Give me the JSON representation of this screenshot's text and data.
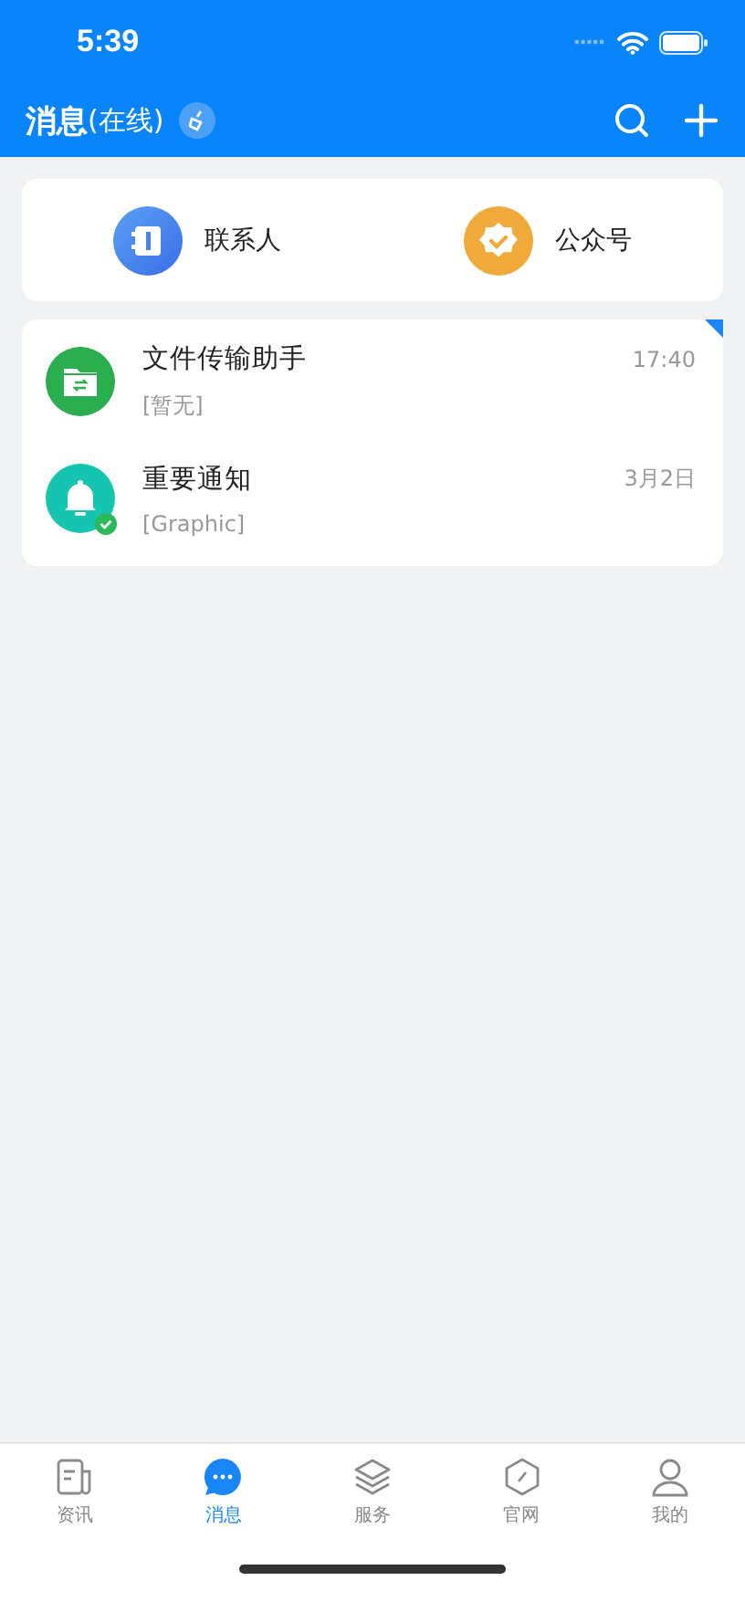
{
  "status_bar": {
    "time": "5:39"
  },
  "header": {
    "title": "消息",
    "status": "(在线)"
  },
  "shortcuts": [
    {
      "label": "联系人",
      "kind": "contacts"
    },
    {
      "label": "公众号",
      "kind": "official"
    }
  ],
  "conversations": [
    {
      "name": "文件传输助手",
      "preview": "[暂无]",
      "time": "17:40",
      "kind": "file",
      "pinned": true,
      "verified": false
    },
    {
      "name": "重要通知",
      "preview": "[Graphic]",
      "time": "3月2日",
      "kind": "notice",
      "pinned": false,
      "verified": true
    }
  ],
  "tab_bar": [
    {
      "label": "资讯",
      "kind": "news",
      "selected": false
    },
    {
      "label": "消息",
      "kind": "chat",
      "selected": true
    },
    {
      "label": "服务",
      "kind": "layers",
      "selected": false
    },
    {
      "label": "官网",
      "kind": "web",
      "selected": false
    },
    {
      "label": "我的",
      "kind": "me",
      "selected": false
    }
  ]
}
